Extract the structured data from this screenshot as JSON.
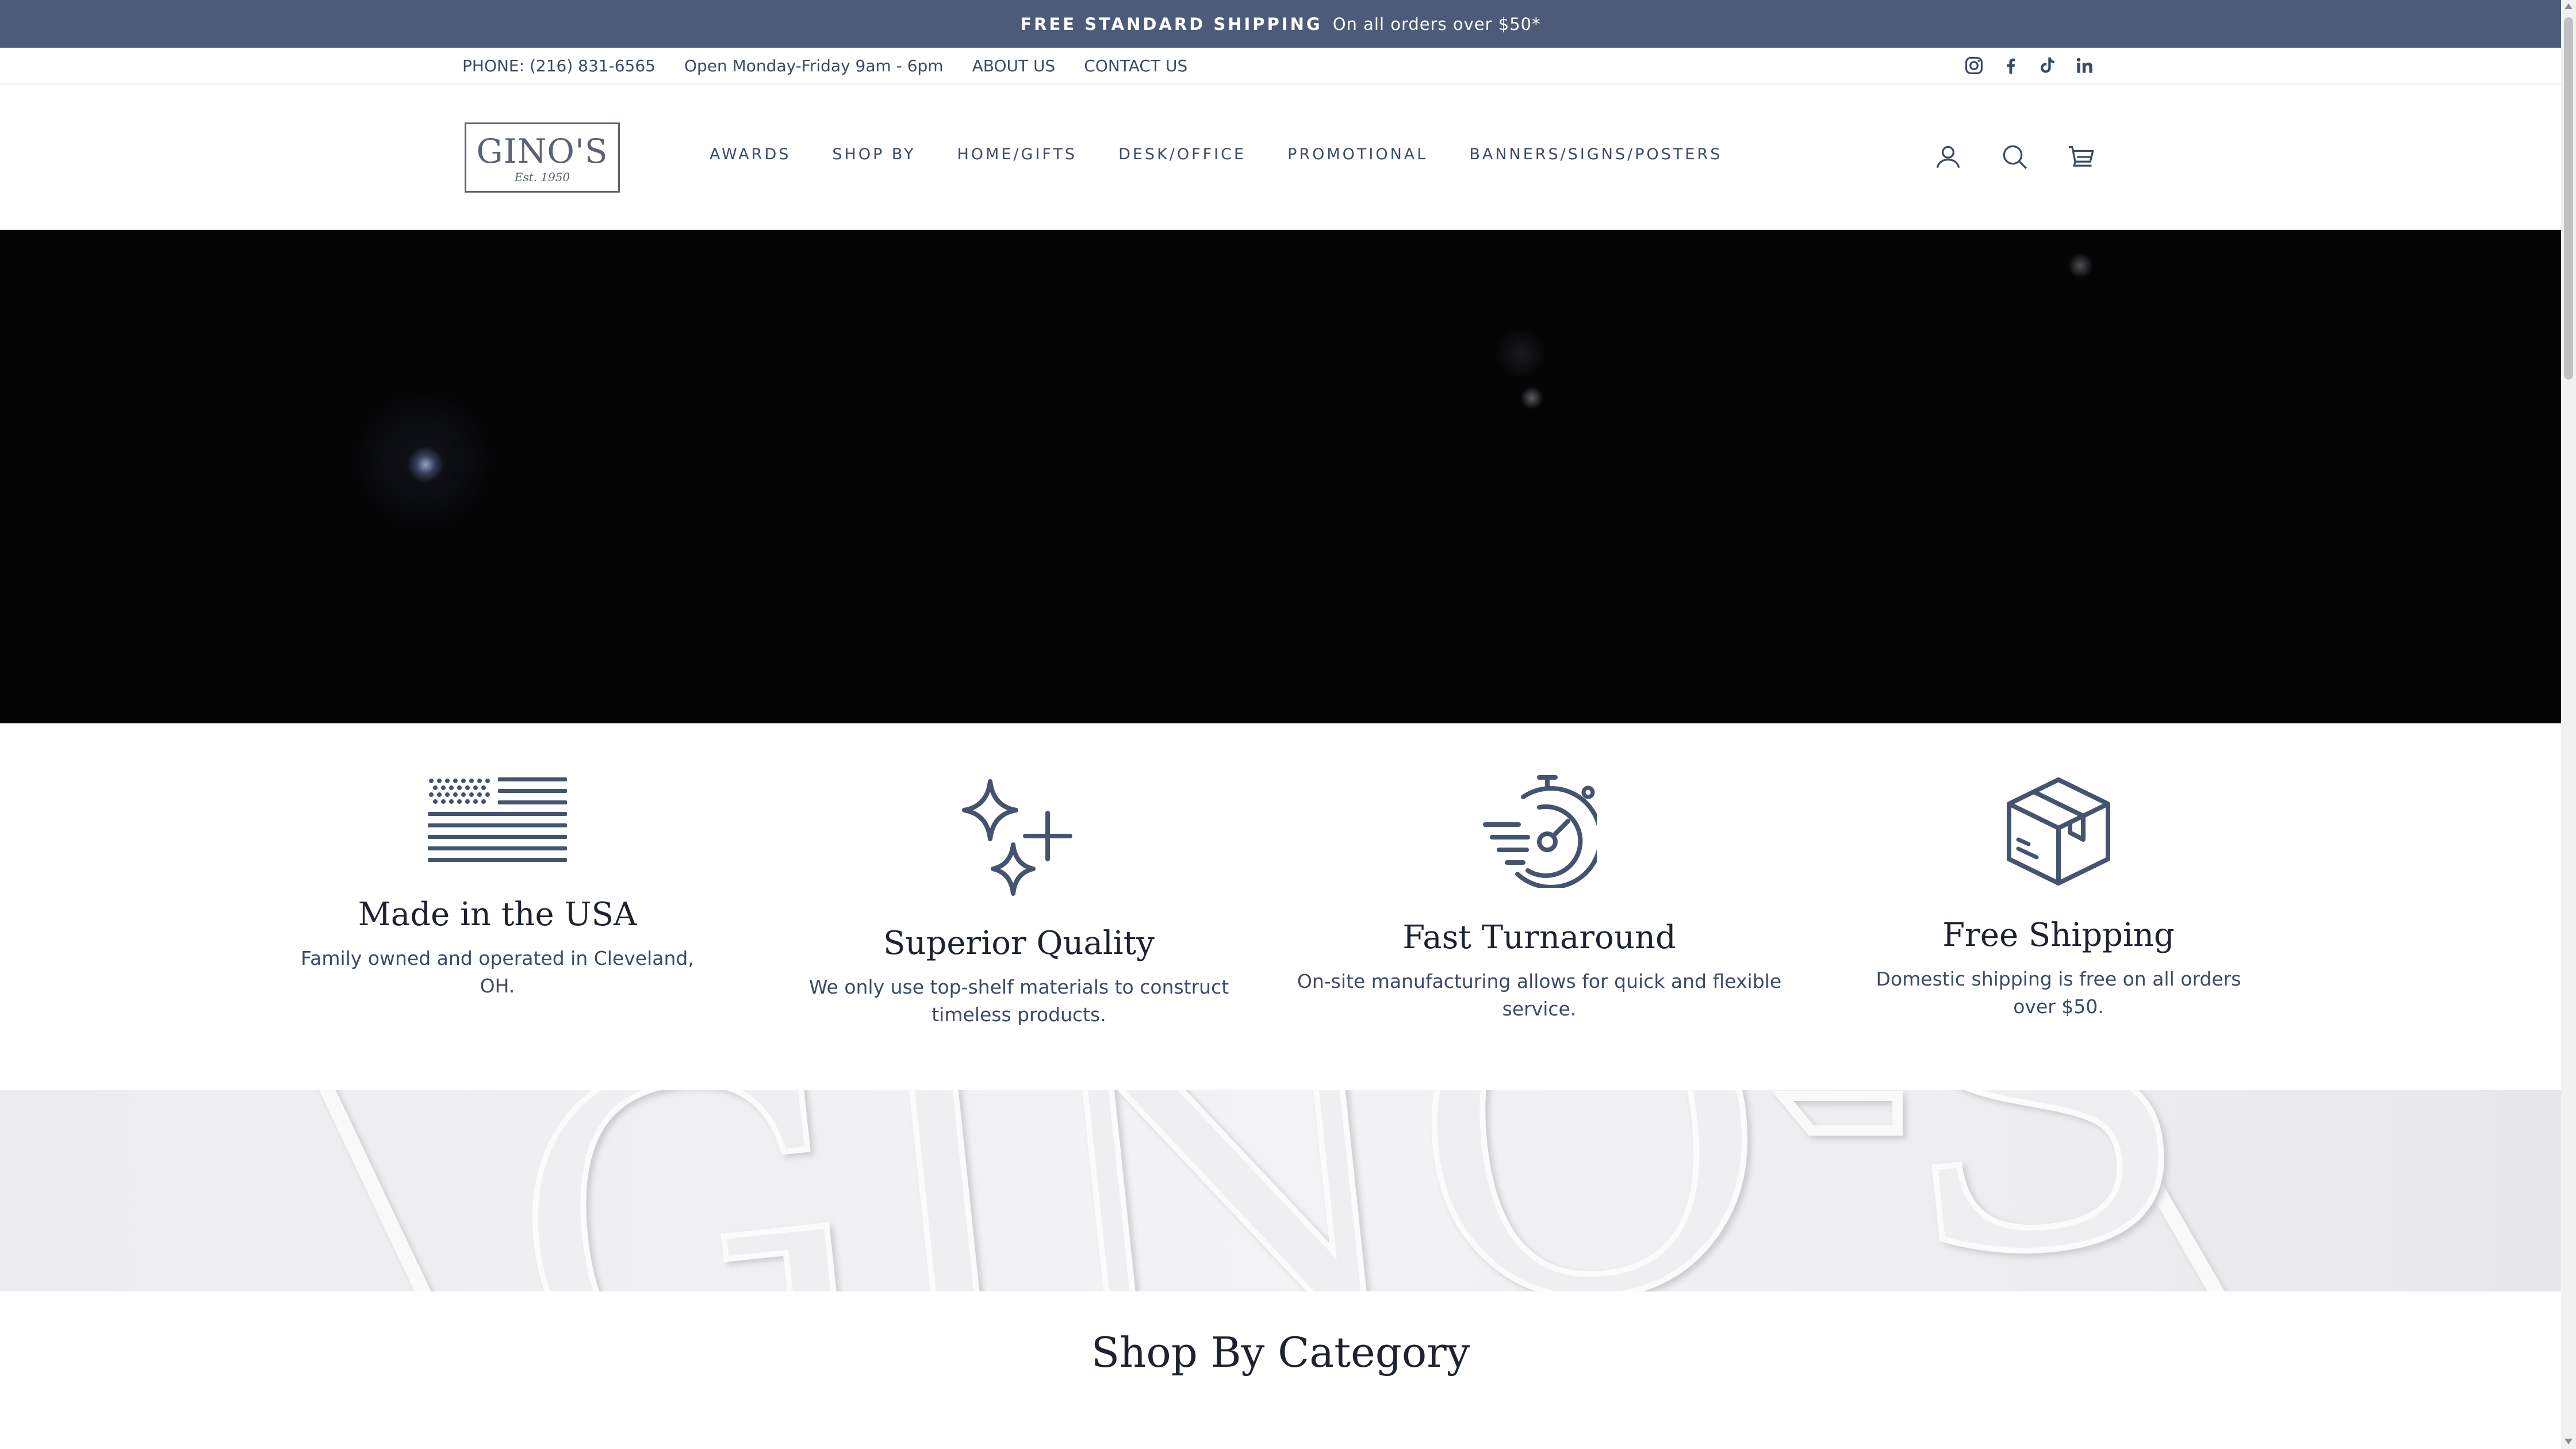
{
  "announcement": {
    "strong": "FREE STANDARD SHIPPING",
    "text": "On all orders over $50*"
  },
  "utility": {
    "phone": "PHONE: (216) 831-6565",
    "hours": "Open Monday-Friday 9am - 6pm",
    "about": "ABOUT US",
    "contact": "CONTACT US",
    "social": [
      "instagram-icon",
      "facebook-icon",
      "tiktok-icon",
      "linkedin-icon"
    ]
  },
  "header": {
    "logo_name": "GINO'S",
    "logo_est": "Est. 1950",
    "nav": [
      "AWARDS",
      "SHOP BY",
      "HOME/GIFTS",
      "DESK/OFFICE",
      "PROMOTIONAL",
      "BANNERS/SIGNS/POSTERS"
    ],
    "icons": [
      "user-icon",
      "search-icon",
      "cart-icon"
    ]
  },
  "features": [
    {
      "icon": "flag-icon",
      "title": "Made in the USA",
      "text": "Family owned and operated in Cleveland, OH."
    },
    {
      "icon": "sparkle-icon",
      "title": "Superior Quality",
      "text": "We only use top-shelf materials to construct timeless products."
    },
    {
      "icon": "stopwatch-icon",
      "title": "Fast Turnaround",
      "text": "On-site manufacturing allows for quick and flexible service."
    },
    {
      "icon": "box-icon",
      "title": "Free Shipping",
      "text": "Domestic shipping is free on all orders over $50."
    }
  ],
  "band_watermark": "GINO'S",
  "section_title": "Shop By Category",
  "colors": {
    "accent": "#4b5b79",
    "text": "#3b4a66",
    "heading": "#1c2230",
    "hero": "#050506"
  }
}
